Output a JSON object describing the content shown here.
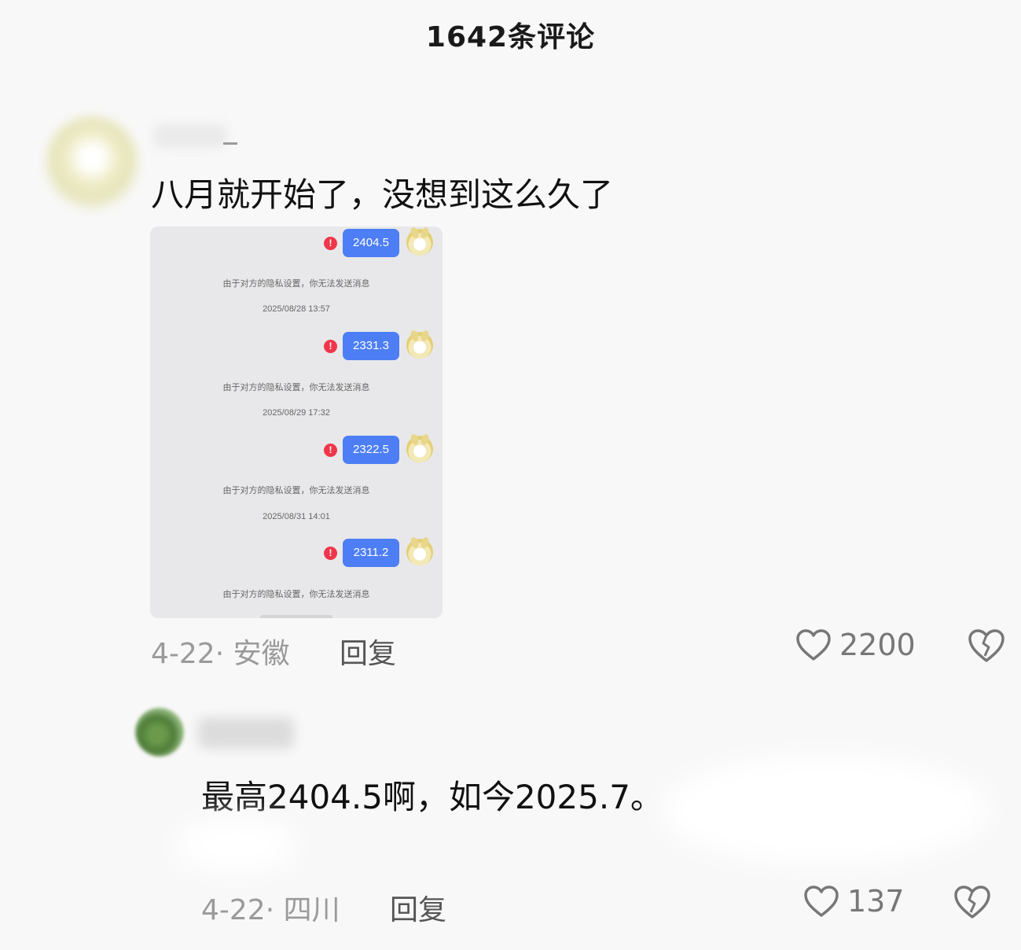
{
  "header": {
    "title": "1642条评论"
  },
  "comments": [
    {
      "text": "八月就开始了，没想到这么久了",
      "date_location": "4-22· 安徽",
      "reply_label": "回复",
      "likes": "2200",
      "attached_screenshot": {
        "messages": [
          {
            "value": "2404.5",
            "notice": "由于对方的隐私设置，你无法发送消息",
            "time": "2025/08/28 13:57"
          },
          {
            "value": "2331.3",
            "notice": "由于对方的隐私设置，你无法发送消息",
            "time": "2025/08/29 17:32"
          },
          {
            "value": "2322.5",
            "notice": "由于对方的隐私设置，你无法发送消息",
            "time": "2025/08/31 14:01"
          },
          {
            "value": "2311.2",
            "notice": "由于对方的隐私设置，你无法发送消息",
            "time": ""
          }
        ],
        "error_glyph": "!"
      }
    },
    {
      "text": "最高2404.5啊，如今2025.7。",
      "date_location": "4-22· 四川",
      "reply_label": "回复",
      "likes": "137"
    }
  ],
  "icons": {
    "like": "heart-outline-icon",
    "dislike": "broken-heart-icon"
  },
  "colors": {
    "bubble": "#4d7ef5",
    "error": "#f0364a",
    "muted_text": "#9a9a9a"
  }
}
